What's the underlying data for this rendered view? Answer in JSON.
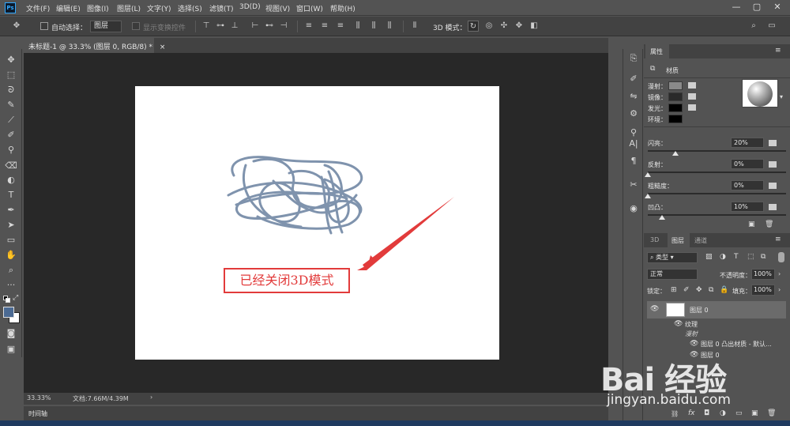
{
  "app": {
    "logo": "Ps"
  },
  "menu": [
    "文件(F)",
    "编辑(E)",
    "图像(I)",
    "图层(L)",
    "文字(Y)",
    "选择(S)",
    "滤镜(T)",
    "3D(D)",
    "视图(V)",
    "窗口(W)",
    "帮助(H)"
  ],
  "window_controls": {
    "minimize": "—",
    "maximize": "▢",
    "close": "✕"
  },
  "options": {
    "auto_select_label": "自动选择：",
    "auto_select_value": "图层",
    "show_transform": "显示变换控件",
    "mode_3d_label": "3D 模式："
  },
  "document": {
    "tab_title": "未标题-1 @ 33.3% (图层 0, RGB/8) *",
    "close": "×",
    "annotation": "已经关闭3D模式",
    "zoom": "33.33%",
    "doc_info": "文档:7.66M/4.39M",
    "timeline": "时间轴"
  },
  "properties": {
    "tab": "属性",
    "sub": "材质",
    "rows": [
      {
        "label": "漫射：",
        "color": "#8a8a8a"
      },
      {
        "label": "镜像：",
        "color": "#2a2a2a"
      },
      {
        "label": "发光：",
        "color": "#000000"
      },
      {
        "label": "环境：",
        "color": "#000000"
      }
    ],
    "sliders": [
      {
        "label": "闪亮：",
        "value": "20%",
        "fraction": 0.2
      },
      {
        "label": "反射：",
        "value": "0%",
        "fraction": 0.0
      },
      {
        "label": "粗糙度：",
        "value": "0%",
        "fraction": 0.0
      },
      {
        "label": "凹凸：",
        "value": "10%",
        "fraction": 0.1
      }
    ]
  },
  "layers": {
    "tabs": [
      "3D",
      "图层",
      "通道"
    ],
    "kind": "类型",
    "blend_mode": "正常",
    "opacity_label": "不透明度：",
    "opacity": "100%",
    "lock_label": "锁定：",
    "fill_label": "填充：",
    "fill": "100%",
    "items": [
      {
        "name": "图层 0",
        "indent": 0
      },
      {
        "name": "纹理",
        "indent": 1
      },
      {
        "name": "漫射",
        "indent": 2
      },
      {
        "name": "图层 0 凸出材质 - 默认...",
        "indent": 3
      },
      {
        "name": "图层 0",
        "indent": 3
      }
    ],
    "footer": [
      "fx"
    ]
  },
  "watermark": {
    "logo": "Bai 经验",
    "url": "jingyan.baidu.com"
  },
  "colors": {
    "accent_red": "#e23b3b",
    "scribble": "#7f93ad",
    "foreground": "#4b6a93"
  }
}
